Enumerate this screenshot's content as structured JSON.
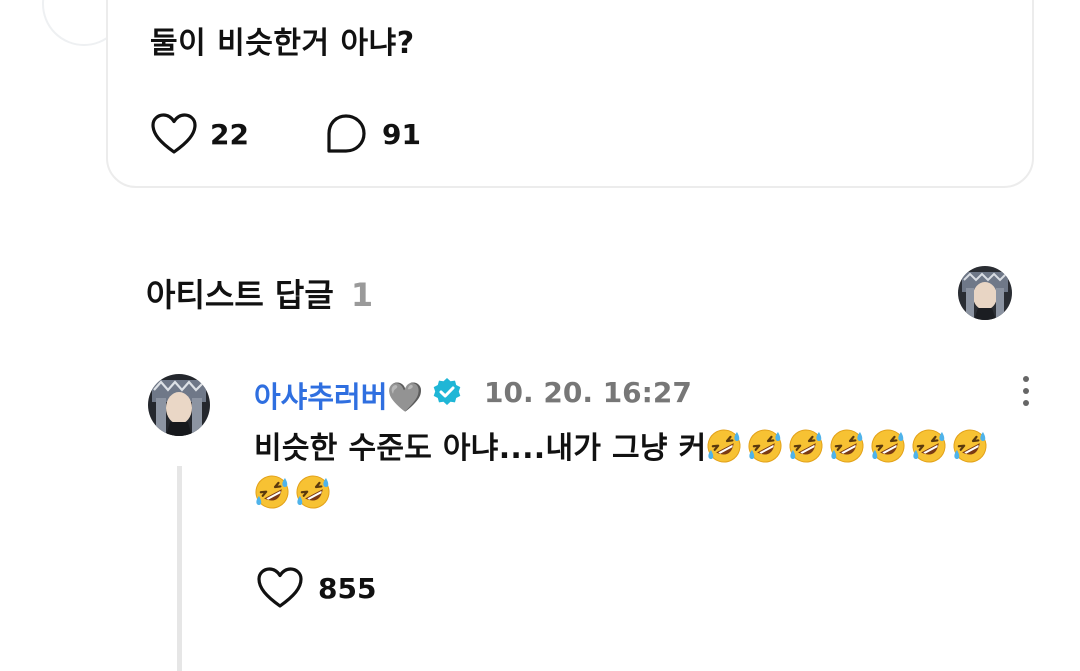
{
  "post": {
    "text": "둘이 비슷한거 아냐?",
    "likes": "22",
    "comments": "91"
  },
  "section": {
    "title": "아티스트 답글",
    "count": "1"
  },
  "reply": {
    "author": "아샤추러버🩶",
    "verified_icon": "verified-badge-icon",
    "timestamp": "10. 20. 16:27",
    "text": "비슷한 수준도 아냐....내가 그냥 커",
    "emoji_name": "rolling-on-the-floor-laughing",
    "emoji_count_line1": 7,
    "emoji_count_line2": 2,
    "likes": "855"
  },
  "colors": {
    "accent": "#2f6fe0",
    "verified": "#1fb6d6",
    "muted": "#9a9a9a"
  }
}
